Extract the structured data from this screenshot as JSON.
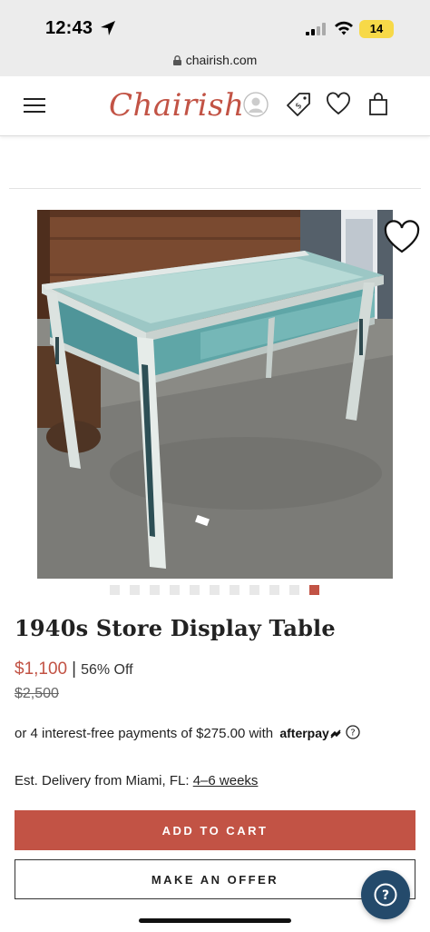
{
  "status_bar": {
    "time": "12:43",
    "battery": "14"
  },
  "browser": {
    "url": "chairish.com"
  },
  "header": {
    "logo": "Chairish",
    "icons": [
      "menu-icon",
      "profile-icon",
      "tag-icon",
      "heart-icon",
      "shopping-bag-icon"
    ]
  },
  "product": {
    "image_alt": "Glass-top display table with distressed teal painted frame",
    "carousel": {
      "count": 11,
      "active_index": 10
    },
    "title": "1940s Store Display Table",
    "price": "$1,100",
    "price_separator": "|",
    "discount": "56% Off",
    "original_price": "$2,500",
    "installments_text": "or 4 interest-free payments of $275.00 with",
    "afterpay_label": "afterpay",
    "delivery_prefix": "Est. Delivery from Miami, FL:",
    "delivery_window": "4–6 weeks"
  },
  "actions": {
    "add_to_cart": "ADD TO CART",
    "make_offer": "MAKE AN OFFER",
    "help": "?"
  },
  "colors": {
    "accent": "#c25345",
    "help_button": "#244a6b"
  }
}
